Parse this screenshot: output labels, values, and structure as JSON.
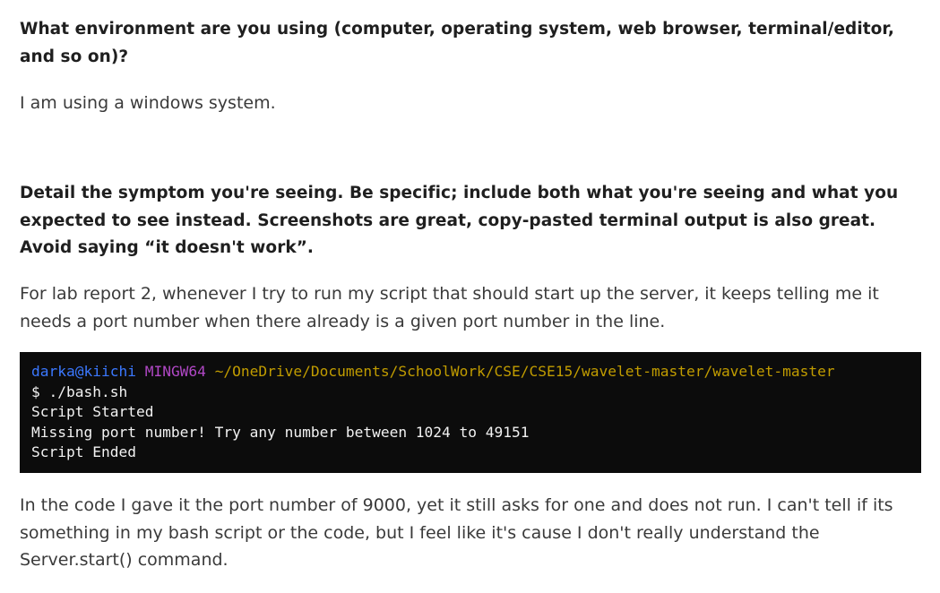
{
  "questions": {
    "environment": {
      "question": "What environment are you using (computer, operating system, web browser, terminal/editor, and so on)?",
      "answer": "I am using a windows system."
    },
    "symptom": {
      "question": "Detail the symptom you're seeing. Be specific; include both what you're seeing and what you expected to see instead. Screenshots are great, copy-pasted terminal output is also great. Avoid saying “it doesn't work”.",
      "answer": "For lab report 2, whenever I try to run my script that should start up the server, it keeps telling me it needs a port number when there already is a given port number in the line."
    }
  },
  "terminal": {
    "user_host": "darka@kiichi",
    "system": "MINGW64",
    "path": "~/OneDrive/Documents/SchoolWork/CSE/CSE15/wavelet-master/wavelet-master",
    "command": "$ ./bash.sh",
    "output": [
      "Script Started",
      "Missing port number! Try any number between 1024 to 49151",
      "Script Ended"
    ],
    "colors": {
      "background": "#0c0c0c",
      "user_host": "#3b78ff",
      "system": "#b148c6",
      "path": "#c19c00",
      "text": "#f2f2f2"
    }
  },
  "followup": "In the code I gave it the port number of 9000, yet it still asks for one and does not run. I can't tell if its something in my bash script or the code, but I feel like it's cause I don't really understand the Server.start() command."
}
